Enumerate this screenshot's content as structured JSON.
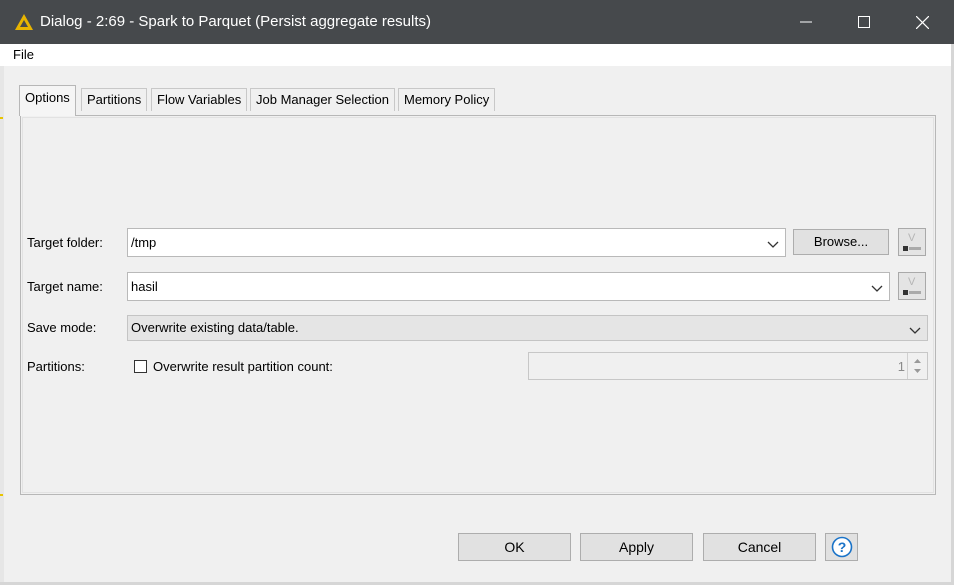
{
  "window": {
    "title": "Dialog - 2:69 - Spark to Parquet (Persist aggregate results)",
    "icon": "warning-triangle-icon",
    "controls": [
      "minimize-icon",
      "maximize-icon",
      "close-icon"
    ]
  },
  "menu": {
    "file_label": "File"
  },
  "tabs": [
    {
      "label": "Options",
      "active": true
    },
    {
      "label": "Partitions"
    },
    {
      "label": "Flow Variables"
    },
    {
      "label": "Job Manager Selection"
    },
    {
      "label": "Memory Policy"
    }
  ],
  "form": {
    "target_folder": {
      "label": "Target folder:",
      "value": "/tmp",
      "browse_label": "Browse..."
    },
    "target_name": {
      "label": "Target name:",
      "value": "hasil"
    },
    "save_mode": {
      "label": "Save mode:",
      "value": "Overwrite existing data/table."
    },
    "partitions": {
      "label": "Partitions:",
      "checkbox_label": "Overwrite result partition count:",
      "checked": false,
      "count": "1"
    }
  },
  "buttons": {
    "ok": "OK",
    "apply": "Apply",
    "cancel": "Cancel",
    "help": "?"
  },
  "colors": {
    "titlebar": "#46494c",
    "warning": "#e8b400",
    "help_accent": "#1a73c8"
  }
}
